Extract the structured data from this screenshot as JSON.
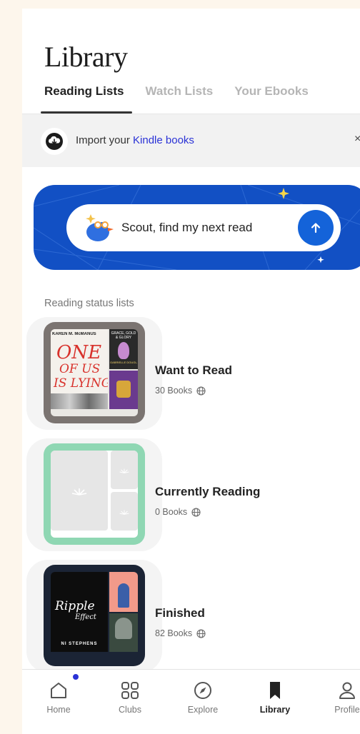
{
  "page": {
    "title": "Library"
  },
  "tabs": [
    {
      "label": "Reading Lists",
      "active": true
    },
    {
      "label": "Watch Lists",
      "active": false
    },
    {
      "label": "Your Ebooks",
      "active": false
    }
  ],
  "import_bar": {
    "prefix": "Import your ",
    "link": "Kindle books",
    "close": "×"
  },
  "scout": {
    "prompt": "Scout, find my next read"
  },
  "section_label": "Reading status lists",
  "lists": [
    {
      "name": "Want to Read",
      "count": "30 Books",
      "frame_color": "#7b7471",
      "covers": [
        {
          "author": "KAREN M. McMANUS",
          "title_lines": [
            "ONE",
            "OF US",
            "IS LYING"
          ]
        },
        {
          "author": "GABRIELLE DOUGLAS",
          "title_lines": [
            "GRACE, GOLD & GLORY"
          ]
        }
      ]
    },
    {
      "name": "Currently Reading",
      "count": "0 Books",
      "frame_color": "#8fd7b3",
      "covers": []
    },
    {
      "name": "Finished",
      "count": "82 Books",
      "frame_color": "#1b2435",
      "covers": [
        {
          "author": "NI STEPHENS",
          "title_lines": [
            "Ripple",
            "Effect"
          ]
        }
      ]
    }
  ],
  "nav": [
    {
      "label": "Home",
      "icon": "home-icon",
      "active": false,
      "badge": true
    },
    {
      "label": "Clubs",
      "icon": "clubs-icon",
      "active": false
    },
    {
      "label": "Explore",
      "icon": "compass-icon",
      "active": false
    },
    {
      "label": "Library",
      "icon": "bookmark-icon",
      "active": true
    },
    {
      "label": "Profile",
      "icon": "profile-icon",
      "active": false
    }
  ],
  "colors": {
    "accent_blue": "#1250c4",
    "link_blue": "#2a32d6",
    "background": "#fdf6ec"
  }
}
